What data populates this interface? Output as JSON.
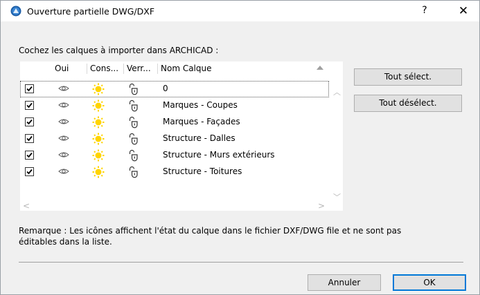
{
  "window": {
    "title": "Ouverture partielle DWG/DXF",
    "help_label": "?",
    "close_label": "✕"
  },
  "instruction": "Cochez les calques à importer dans ARCHICAD :",
  "columns": [
    "Oui",
    "Cons...",
    "Verr...",
    "Nom Calque"
  ],
  "layers": [
    {
      "checked": true,
      "name": "0"
    },
    {
      "checked": true,
      "name": "Marques - Coupes"
    },
    {
      "checked": true,
      "name": "Marques - Façades"
    },
    {
      "checked": true,
      "name": "Structure - Dalles"
    },
    {
      "checked": true,
      "name": "Structure - Murs extérieurs"
    },
    {
      "checked": true,
      "name": "Structure - Toitures"
    }
  ],
  "buttons": {
    "select_all": "Tout sélect.",
    "deselect_all": "Tout désélect.",
    "cancel": "Annuler",
    "ok": "OK"
  },
  "remark_line1": "Remarque : Les icônes affichent l'état du calque dans le fichier DXF/DWG file et ne sont pas",
  "remark_line2": "éditables dans la liste.",
  "colors": {
    "sun": "#ffd400",
    "accent": "#0078d7"
  }
}
